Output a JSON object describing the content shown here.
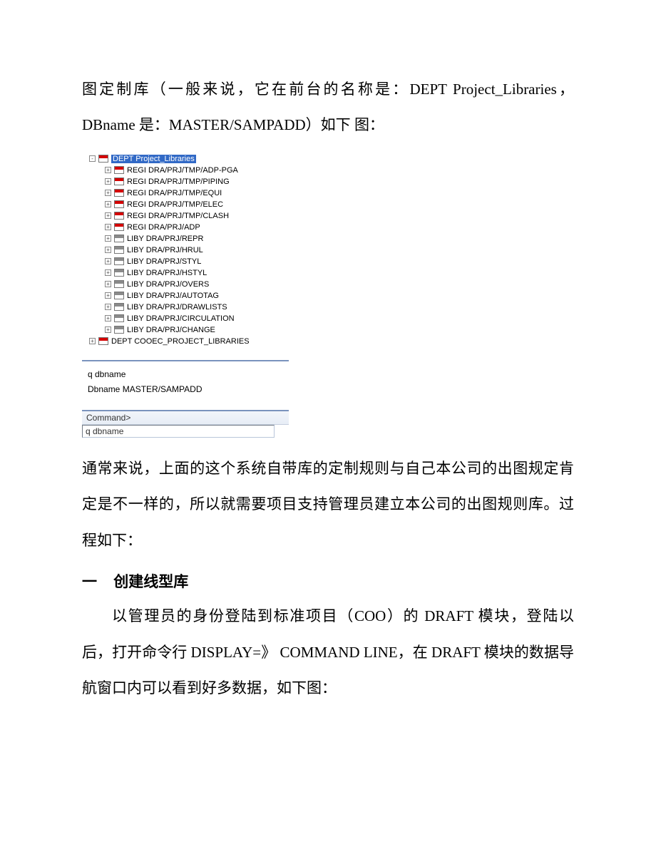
{
  "text": {
    "p1_l1": "图定制库（一般来说，它在前台的名称是：DEPT",
    "p1_l2": "Project_Libraries，DBname 是：MASTER/SAMPADD）如下",
    "p1_l3": "图：",
    "p2": "通常来说，上面的这个系统自带库的定制规则与自己本公司的出图规定肯定是不一样的，所以就需要项目支持管理员建立本公司的出图规则库。过程如下：",
    "h1_num": "一",
    "h1_title": "创建线型库",
    "p3": "以管理员的身份登陆到标准项目（COO）的 DRAFT 模块，登陆以后，打开命令行 DISPLAY=》 COMMAND LINE，在 DRAFT 模块的数据导航窗口内可以看到好多数据，如下图："
  },
  "tree": {
    "root": {
      "exp": "-",
      "icon": "red",
      "label": "DEPT Project_Libraries",
      "selected": true
    },
    "children": [
      {
        "exp": "+",
        "icon": "red",
        "label": "REGI DRA/PRJ/TMP/ADP-PGA"
      },
      {
        "exp": "+",
        "icon": "red",
        "label": "REGI DRA/PRJ/TMP/PIPING"
      },
      {
        "exp": "+",
        "icon": "red",
        "label": "REGI DRA/PRJ/TMP/EQUI"
      },
      {
        "exp": "+",
        "icon": "red",
        "label": "REGI DRA/PRJ/TMP/ELEC"
      },
      {
        "exp": "+",
        "icon": "red",
        "label": "REGI DRA/PRJ/TMP/CLASH"
      },
      {
        "exp": "+",
        "icon": "red",
        "label": "REGI DRA/PRJ/ADP"
      },
      {
        "exp": "+",
        "icon": "grey",
        "label": "LIBY DRA/PRJ/REPR"
      },
      {
        "exp": "+",
        "icon": "grey",
        "label": "LIBY DRA/PRJ/HRUL"
      },
      {
        "exp": "+",
        "icon": "grey",
        "label": "LIBY DRA/PRJ/STYL"
      },
      {
        "exp": "+",
        "icon": "grey",
        "label": "LIBY DRA/PRJ/HSTYL"
      },
      {
        "exp": "+",
        "icon": "grey",
        "label": "LIBY DRA/PRJ/OVERS"
      },
      {
        "exp": "+",
        "icon": "grey",
        "label": "LIBY DRA/PRJ/AUTOTAG"
      },
      {
        "exp": "+",
        "icon": "grey",
        "label": "LIBY DRA/PRJ/DRAWLISTS"
      },
      {
        "exp": "+",
        "icon": "grey",
        "label": "LIBY DRA/PRJ/CIRCULATION"
      },
      {
        "exp": "+",
        "icon": "grey",
        "label": "LIBY DRA/PRJ/CHANGE"
      }
    ],
    "sibling": {
      "exp": "+",
      "icon": "red",
      "label": "DEPT COOEC_PROJECT_LIBRARIES"
    }
  },
  "console": {
    "line1": "q dbname",
    "line2": "Dbname MASTER/SAMPADD",
    "prompt": "Command>",
    "input": "q dbname"
  }
}
